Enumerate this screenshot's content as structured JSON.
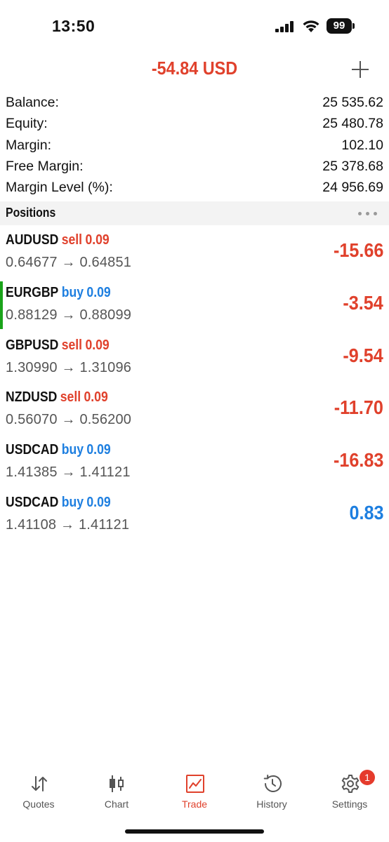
{
  "status_bar": {
    "time": "13:50",
    "battery": "99"
  },
  "header": {
    "total_profit": "-54.84 USD"
  },
  "summary": [
    {
      "label": "Balance:",
      "value": "25 535.62"
    },
    {
      "label": "Equity:",
      "value": "25 480.78"
    },
    {
      "label": "Margin:",
      "value": "102.10"
    },
    {
      "label": "Free Margin:",
      "value": "25 378.68"
    },
    {
      "label": "Margin Level (%):",
      "value": "24 956.69"
    }
  ],
  "positions_section": {
    "title": "Positions"
  },
  "positions": [
    {
      "symbol": "AUDUSD",
      "side": "sell",
      "volume": "0.09",
      "open_price": "0.64677",
      "current_price": "0.64851",
      "profit": "-15.66"
    },
    {
      "symbol": "EURGBP",
      "side": "buy",
      "volume": "0.09",
      "open_price": "0.88129",
      "current_price": "0.88099",
      "profit": "-3.54"
    },
    {
      "symbol": "GBPUSD",
      "side": "sell",
      "volume": "0.09",
      "open_price": "1.30990",
      "current_price": "1.31096",
      "profit": "-9.54"
    },
    {
      "symbol": "NZDUSD",
      "side": "sell",
      "volume": "0.09",
      "open_price": "0.56070",
      "current_price": "0.56200",
      "profit": "-11.70"
    },
    {
      "symbol": "USDCAD",
      "side": "buy",
      "volume": "0.09",
      "open_price": "1.41385",
      "current_price": "1.41121",
      "profit": "-16.83"
    },
    {
      "symbol": "USDCAD",
      "side": "buy",
      "volume": "0.09",
      "open_price": "1.41108",
      "current_price": "1.41121",
      "profit": "0.83"
    }
  ],
  "price_arrow": "→",
  "tabs": [
    {
      "label": "Quotes",
      "icon": "quotes-arrows-icon"
    },
    {
      "label": "Chart",
      "icon": "candlestick-icon"
    },
    {
      "label": "Trade",
      "icon": "trade-chart-icon"
    },
    {
      "label": "History",
      "icon": "history-clock-icon"
    },
    {
      "label": "Settings",
      "icon": "gear-icon",
      "badge": "1"
    }
  ],
  "colors": {
    "loss": "#e0412c",
    "gain": "#1e7fe0",
    "sell": "#e0412c",
    "buy": "#1e7fe0",
    "active_tab": "#e0412c",
    "selected_marker": "#1aa31a"
  }
}
